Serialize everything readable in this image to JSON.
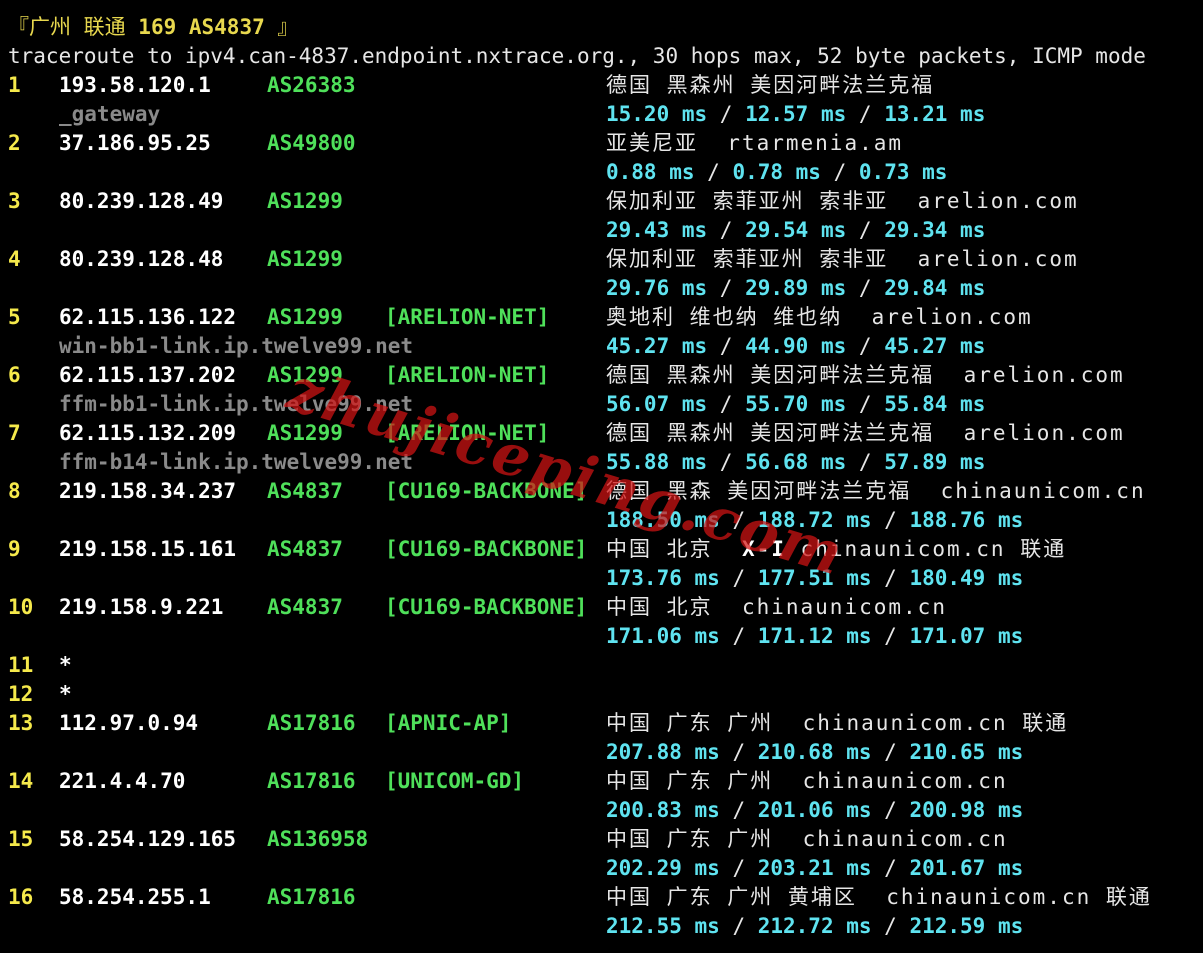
{
  "header": {
    "title_prefix": "『广州 联通 ",
    "title_bold": "169 AS4837",
    "title_suffix": " 』",
    "command": "traceroute to ipv4.can-4837.endpoint.nxtrace.org., 30 hops max, 52 byte packets, ICMP mode"
  },
  "hops": [
    {
      "hop": "1",
      "ip": "193.58.120.1",
      "asn": "AS26383",
      "net": "",
      "geo": "德国 黑森州 美因河畔法兰克福",
      "geo_extra": "",
      "host": "_gateway",
      "rtt": [
        "15.20 ms",
        "12.57 ms",
        "13.21 ms"
      ]
    },
    {
      "hop": "2",
      "ip": "37.186.95.25",
      "asn": "AS49800",
      "net": "",
      "geo": "亚美尼亚",
      "geo_extra": "rtarmenia.am",
      "host": "",
      "rtt": [
        "0.88 ms",
        "0.78 ms",
        "0.73 ms"
      ]
    },
    {
      "hop": "3",
      "ip": "80.239.128.49",
      "asn": "AS1299",
      "net": "",
      "geo": "保加利亚 索菲亚州 索非亚",
      "geo_extra": "arelion.com",
      "host": "",
      "rtt": [
        "29.43 ms",
        "29.54 ms",
        "29.34 ms"
      ]
    },
    {
      "hop": "4",
      "ip": "80.239.128.48",
      "asn": "AS1299",
      "net": "",
      "geo": "保加利亚 索菲亚州 索非亚",
      "geo_extra": "arelion.com",
      "host": "",
      "rtt": [
        "29.76 ms",
        "29.89 ms",
        "29.84 ms"
      ]
    },
    {
      "hop": "5",
      "ip": "62.115.136.122",
      "asn": "AS1299",
      "net": "[ARELION-NET]",
      "geo": "奥地利 维也纳 维也纳",
      "geo_extra": "arelion.com",
      "host": "win-bb1-link.ip.twelve99.net",
      "rtt": [
        "45.27 ms",
        "44.90 ms",
        "45.27 ms"
      ]
    },
    {
      "hop": "6",
      "ip": "62.115.137.202",
      "asn": "AS1299",
      "net": "[ARELION-NET]",
      "geo": "德国 黑森州 美因河畔法兰克福",
      "geo_extra": "arelion.com",
      "host": "ffm-bb1-link.ip.twelve99.net",
      "rtt": [
        "56.07 ms",
        "55.70 ms",
        "55.84 ms"
      ]
    },
    {
      "hop": "7",
      "ip": "62.115.132.209",
      "asn": "AS1299",
      "net": "[ARELION-NET]",
      "geo": "德国 黑森州 美因河畔法兰克福",
      "geo_extra": "arelion.com",
      "host": "ffm-b14-link.ip.twelve99.net",
      "rtt": [
        "55.88 ms",
        "56.68 ms",
        "57.89 ms"
      ]
    },
    {
      "hop": "8",
      "ip": "219.158.34.237",
      "asn": "AS4837",
      "net": "[CU169-BACKBONE]",
      "geo": "德国 黑森 美因河畔法兰克福",
      "geo_extra": "chinaunicom.cn",
      "host": "",
      "rtt": [
        "188.50 ms",
        "188.72 ms",
        "188.76 ms"
      ]
    },
    {
      "hop": "9",
      "ip": "219.158.15.161",
      "asn": "AS4837",
      "net": "[CU169-BACKBONE]",
      "geo": "中国 北京",
      "geo_bold": "X-I",
      "geo_extra": "chinaunicom.cn 联通",
      "host": "",
      "rtt": [
        "173.76 ms",
        "177.51 ms",
        "180.49 ms"
      ]
    },
    {
      "hop": "10",
      "ip": "219.158.9.221",
      "asn": "AS4837",
      "net": "[CU169-BACKBONE]",
      "geo": "中国 北京",
      "geo_extra": "chinaunicom.cn",
      "host": "",
      "rtt": [
        "171.06 ms",
        "171.12 ms",
        "171.07 ms"
      ]
    },
    {
      "hop": "11",
      "ip": "*"
    },
    {
      "hop": "12",
      "ip": "*"
    },
    {
      "hop": "13",
      "ip": "112.97.0.94",
      "asn": "AS17816",
      "net": "[APNIC-AP]",
      "geo": "中国 广东 广州",
      "geo_extra": "chinaunicom.cn 联通",
      "host": "",
      "rtt": [
        "207.88 ms",
        "210.68 ms",
        "210.65 ms"
      ]
    },
    {
      "hop": "14",
      "ip": "221.4.4.70",
      "asn": "AS17816",
      "net": "[UNICOM-GD]",
      "geo": "中国 广东 广州",
      "geo_extra": "chinaunicom.cn",
      "host": "",
      "rtt": [
        "200.83 ms",
        "201.06 ms",
        "200.98 ms"
      ]
    },
    {
      "hop": "15",
      "ip": "58.254.129.165",
      "asn": "AS136958",
      "net": "",
      "geo": "中国 广东 广州",
      "geo_extra": "chinaunicom.cn",
      "host": "",
      "rtt": [
        "202.29 ms",
        "203.21 ms",
        "201.67 ms"
      ]
    },
    {
      "hop": "16",
      "ip": "58.254.255.1",
      "asn": "AS17816",
      "net": "",
      "geo": "中国 广东 广州 黄埔区",
      "geo_extra": "chinaunicom.cn 联通",
      "host": "",
      "rtt": [
        "212.55 ms",
        "212.72 ms",
        "212.59 ms"
      ]
    }
  ],
  "watermark": "zhujiceping.com",
  "colors": {
    "hop": "#f5e94b",
    "ip": "#ffffff",
    "asn": "#4fe05a",
    "rtt": "#5fe3f0",
    "host": "#8a8a8a",
    "watermark": "#d21414"
  }
}
